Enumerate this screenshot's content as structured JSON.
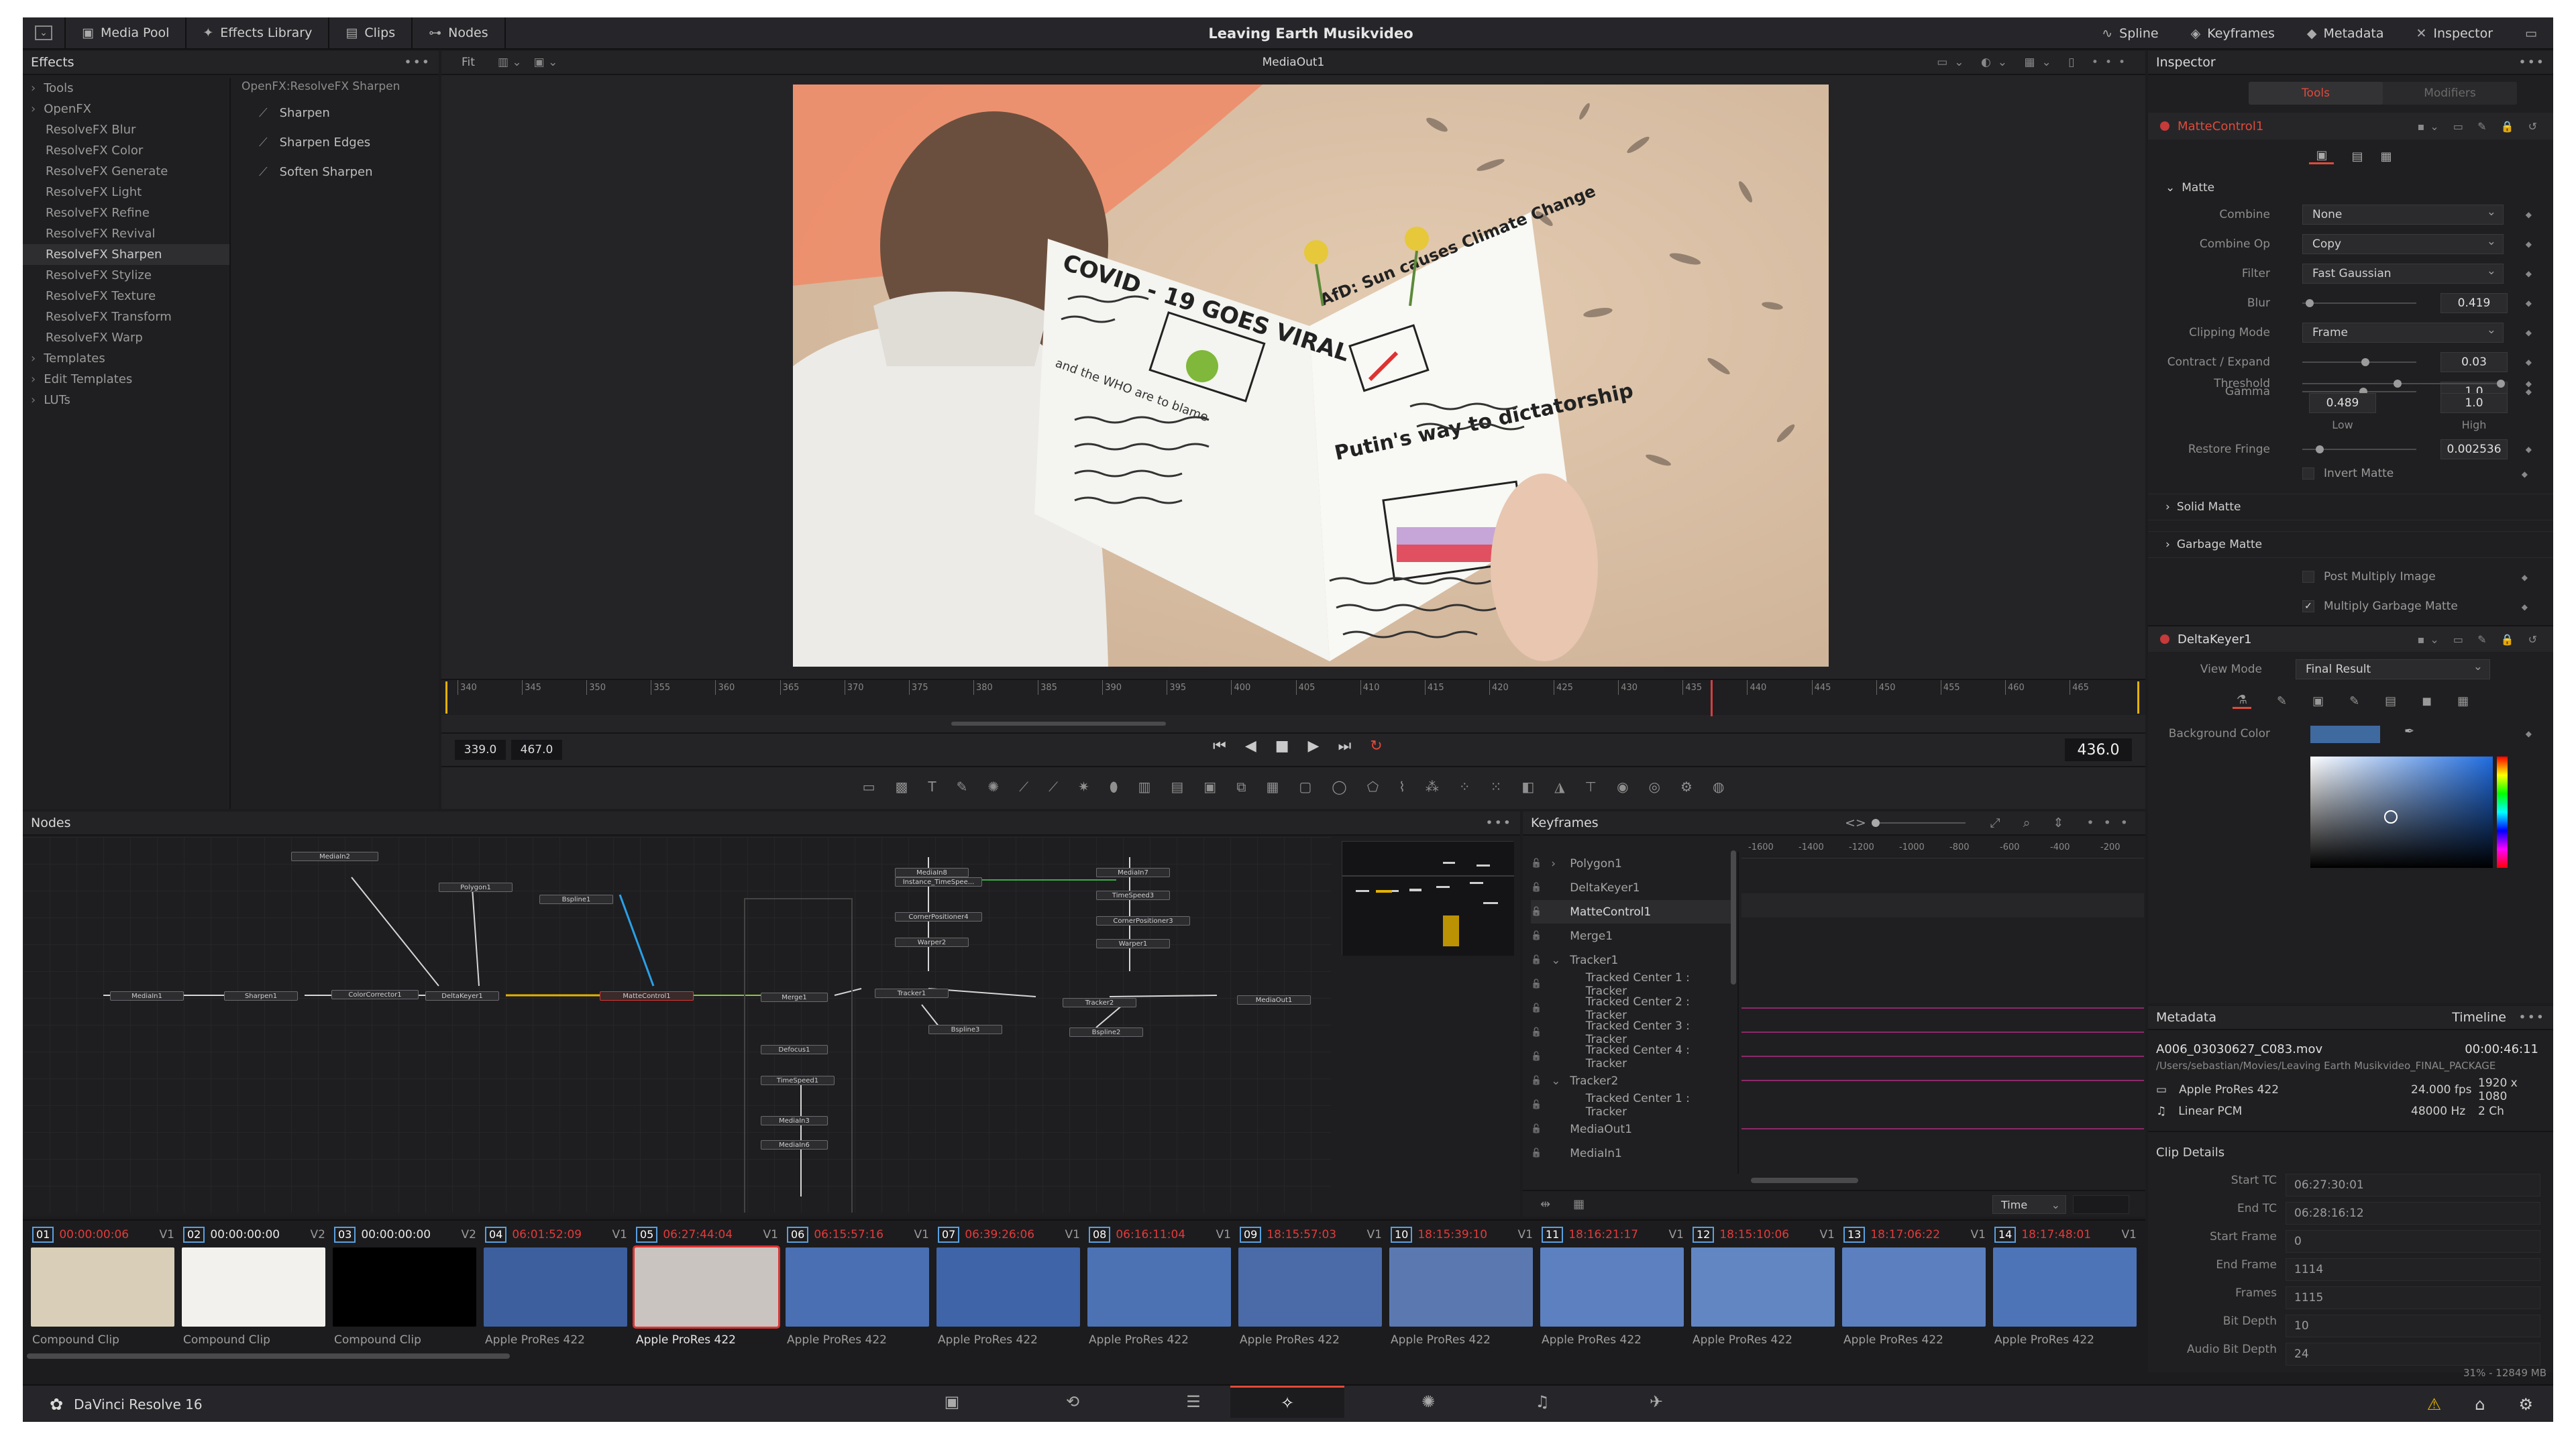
{
  "window": {
    "title": "Leaving Earth Musikvideo"
  },
  "toolbar": {
    "left": [
      "Media Pool",
      "Effects Library",
      "Clips",
      "Nodes"
    ],
    "right": [
      "Spline",
      "Keyframes",
      "Metadata",
      "Inspector"
    ]
  },
  "effects": {
    "title": "Effects",
    "tree": [
      {
        "label": "Tools",
        "top": true
      },
      {
        "label": "OpenFX",
        "top": true
      },
      {
        "label": "ResolveFX Blur"
      },
      {
        "label": "ResolveFX Color"
      },
      {
        "label": "ResolveFX Generate"
      },
      {
        "label": "ResolveFX Light"
      },
      {
        "label": "ResolveFX Refine"
      },
      {
        "label": "ResolveFX Revival"
      },
      {
        "label": "ResolveFX Sharpen",
        "selected": true
      },
      {
        "label": "ResolveFX Stylize"
      },
      {
        "label": "ResolveFX Texture"
      },
      {
        "label": "ResolveFX Transform"
      },
      {
        "label": "ResolveFX Warp"
      },
      {
        "label": "Templates",
        "top": true
      },
      {
        "label": "Edit Templates",
        "top": true
      },
      {
        "label": "LUTs",
        "top": true
      }
    ],
    "path": "OpenFX:ResolveFX Sharpen",
    "items": [
      "Sharpen",
      "Sharpen Edges",
      "Soften Sharpen"
    ]
  },
  "viewer": {
    "fit": "Fit",
    "name": "MediaOut1",
    "ruler": [
      "340",
      "345",
      "350",
      "355",
      "360",
      "365",
      "370",
      "375",
      "380",
      "385",
      "390",
      "395",
      "400",
      "405",
      "410",
      "415",
      "420",
      "425",
      "430",
      "435",
      "440",
      "445",
      "450",
      "455",
      "460",
      "465"
    ],
    "in": "339.0",
    "out": "467.0",
    "frame": "436.0",
    "newspaper": {
      "headline1": "COVID - 19 GOES VIRAL",
      "headline2": "AfD: Sun causes Climate Change",
      "headline3": "Putin's way to dictatorship",
      "sub": "and the WHO are to blame"
    }
  },
  "inspector": {
    "title": "Inspector",
    "tabs": [
      "Tools",
      "Modifiers"
    ],
    "node1": "MatteControl1",
    "section_matte": "Matte",
    "rows": [
      {
        "label": "Combine",
        "value": "None",
        "kind": "dd"
      },
      {
        "label": "Combine Op",
        "value": "Copy",
        "kind": "dd"
      },
      {
        "label": "Filter",
        "value": "Fast Gaussian",
        "kind": "dd"
      },
      {
        "label": "Blur",
        "value": "0.419",
        "kind": "slider",
        "pos": 0.03
      },
      {
        "label": "Clipping Mode",
        "value": "Frame",
        "kind": "dd"
      },
      {
        "label": "Contract / Expand",
        "value": "0.03",
        "kind": "slider",
        "pos": 0.52
      },
      {
        "label": "Gamma",
        "value": "1.0",
        "kind": "slider",
        "pos": 0.5
      }
    ],
    "threshold": {
      "label": "Threshold",
      "low": "0.489",
      "high": "1.0",
      "low_label": "Low",
      "high_label": "High"
    },
    "restore_fringe": {
      "label": "Restore Fringe",
      "value": "0.002536"
    },
    "invert_matte": "Invert Matte",
    "solid_matte": "Solid Matte",
    "garbage_matte": "Garbage Matte",
    "post_multiply": "Post Multiply Image",
    "multiply_garbage": "Multiply Garbage Matte",
    "node2": "DeltaKeyer1",
    "view_mode_label": "View Mode",
    "view_mode": "Final Result",
    "bg_color_label": "Background Color"
  },
  "nodes": {
    "title": "Nodes",
    "list": [
      "MediaIn2",
      "Polygon1",
      "Bspline1",
      "MediaIn1",
      "Sharpen1",
      "ColorCorrector1",
      "DeltaKeyer1",
      "MatteControl1",
      "Merge1",
      "MediaIn8",
      "Instance_TimeSpee...",
      "CornerPositioner4",
      "Warper2",
      "Tracker1",
      "Bspline3",
      "MediaIn7",
      "TimeSpeed3",
      "CornerPositioner3",
      "Warper1",
      "Tracker2",
      "Bspline2",
      "MediaOut1",
      "Defocus1",
      "TimeSpeed1",
      "MediaIn3",
      "MediaIn6"
    ]
  },
  "keyframes": {
    "title": "Keyframes",
    "items": [
      {
        "label": "Polygon1",
        "indent": 1,
        "arrow": ">"
      },
      {
        "label": "DeltaKeyer1",
        "indent": 1
      },
      {
        "label": "MatteControl1",
        "indent": 1,
        "selected": true
      },
      {
        "label": "Merge1",
        "indent": 1
      },
      {
        "label": "Tracker1",
        "indent": 1,
        "arrow": "v"
      },
      {
        "label": "Tracked Center 1 : Tracker",
        "indent": 2
      },
      {
        "label": "Tracked Center 2 : Tracker",
        "indent": 2
      },
      {
        "label": "Tracked Center 3 : Tracker",
        "indent": 2
      },
      {
        "label": "Tracked Center 4 : Tracker",
        "indent": 2
      },
      {
        "label": "Tracker2",
        "indent": 1,
        "arrow": "v"
      },
      {
        "label": "Tracked Center 1 : Tracker",
        "indent": 2
      },
      {
        "label": "MediaOut1",
        "indent": 1
      },
      {
        "label": "MediaIn1",
        "indent": 1
      }
    ],
    "ruler": [
      "-1600",
      "-1400",
      "-1200",
      "-1000",
      "-800",
      "-600",
      "-400",
      "-200"
    ],
    "time_mode": "Time"
  },
  "metadata": {
    "title": "Metadata",
    "timeline_label": "Timeline",
    "file": "A006_03030627_C083.mov",
    "duration": "00:00:46:11",
    "path": "/Users/sebastian/Movies/Leaving Earth Musikvideo_FINAL_PACKAGE",
    "codec": "Apple ProRes 422",
    "fps": "24.000 fps",
    "res": "1920 x 1080",
    "audio": "Linear PCM",
    "hz": "48000 Hz",
    "ch": "2 Ch",
    "clip_details": "Clip Details",
    "fields": [
      {
        "k": "Start TC",
        "v": "06:27:30:01"
      },
      {
        "k": "End TC",
        "v": "06:28:16:12"
      },
      {
        "k": "Start Frame",
        "v": "0"
      },
      {
        "k": "End Frame",
        "v": "1114"
      },
      {
        "k": "Frames",
        "v": "1115"
      },
      {
        "k": "Bit Depth",
        "v": "10"
      },
      {
        "k": "Audio Bit Depth",
        "v": "24"
      }
    ]
  },
  "clips": [
    {
      "num": "01",
      "tc": "00:00:00:06",
      "trk": "V1",
      "cap": "Compound Clip",
      "red": true,
      "bg": "#d9cfb8"
    },
    {
      "num": "02",
      "tc": "00:00:00:00",
      "trk": "V2",
      "cap": "Compound Clip",
      "red": false,
      "bg": "#f2f1ee"
    },
    {
      "num": "03",
      "tc": "00:00:00:00",
      "trk": "V2",
      "cap": "Compound Clip",
      "red": false,
      "bg": "#000000"
    },
    {
      "num": "04",
      "tc": "06:01:52:09",
      "trk": "V1",
      "cap": "Apple ProRes 422",
      "red": true,
      "bg": "#3d5f9e"
    },
    {
      "num": "05",
      "tc": "06:27:44:04",
      "trk": "V1",
      "cap": "Apple ProRes 422",
      "red": true,
      "bg": "#c9c4bf",
      "selected": true
    },
    {
      "num": "06",
      "tc": "06:15:57:16",
      "trk": "V1",
      "cap": "Apple ProRes 422",
      "red": true,
      "bg": "#4a6fb2"
    },
    {
      "num": "07",
      "tc": "06:39:26:06",
      "trk": "V1",
      "cap": "Apple ProRes 422",
      "red": true,
      "bg": "#3f64a8"
    },
    {
      "num": "08",
      "tc": "06:16:11:04",
      "trk": "V1",
      "cap": "Apple ProRes 422",
      "red": true,
      "bg": "#4d72b4"
    },
    {
      "num": "09",
      "tc": "18:15:57:03",
      "trk": "V1",
      "cap": "Apple ProRes 422",
      "red": true,
      "bg": "#4a6aa8"
    },
    {
      "num": "10",
      "tc": "18:15:39:10",
      "trk": "V1",
      "cap": "Apple ProRes 422",
      "red": true,
      "bg": "#5b79b0"
    },
    {
      "num": "11",
      "tc": "18:16:21:17",
      "trk": "V1",
      "cap": "Apple ProRes 422",
      "red": true,
      "bg": "#5d80c0"
    },
    {
      "num": "12",
      "tc": "18:15:10:06",
      "trk": "V1",
      "cap": "Apple ProRes 422",
      "red": true,
      "bg": "#6286c2"
    },
    {
      "num": "13",
      "tc": "18:17:06:22",
      "trk": "V1",
      "cap": "Apple ProRes 422",
      "red": true,
      "bg": "#5b7fbf"
    },
    {
      "num": "14",
      "tc": "18:17:48:01",
      "trk": "V1",
      "cap": "Apple ProRes 422",
      "red": true,
      "bg": "#4e74b8"
    }
  ],
  "status": {
    "mem": "31% - 12849 MB",
    "app": "DaVinci Resolve 16"
  }
}
